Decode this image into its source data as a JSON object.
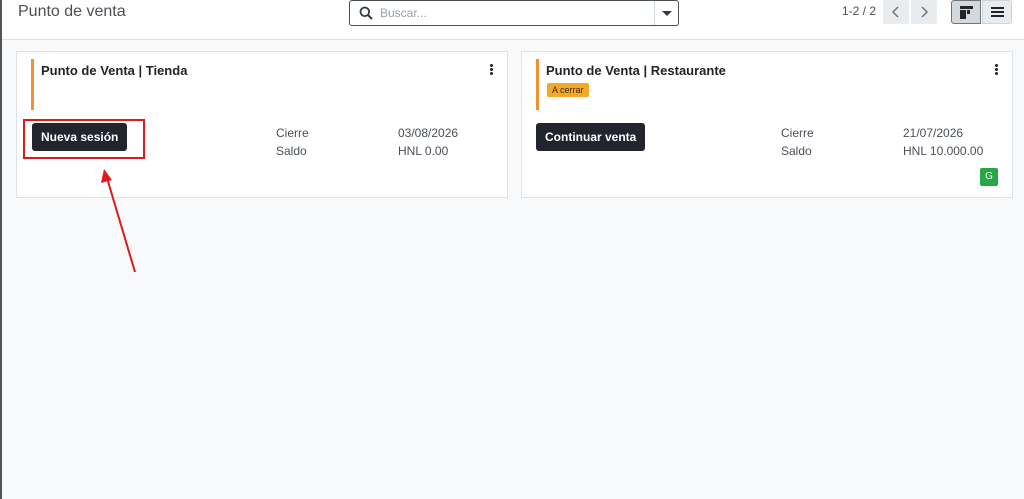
{
  "header": {
    "breadcrumb": "Punto de venta",
    "search": {
      "placeholder": "Buscar...",
      "value": ""
    },
    "pager": {
      "value": "1-2 / 2"
    }
  },
  "cards": [
    {
      "title": "Punto de Venta | Tienda",
      "badge": "",
      "action_label": "Nueva sesión",
      "fields": [
        {
          "label": "Cierre",
          "value": "03/08/2026"
        },
        {
          "label": "Saldo",
          "value": "HNL 0.00"
        }
      ]
    },
    {
      "title": "Punto de Venta | Restaurante",
      "badge": "A cerrar",
      "action_label": "Continuar venta",
      "fields": [
        {
          "label": "Cierre",
          "value": "21/07/2026"
        },
        {
          "label": "Saldo",
          "value": "HNL 10.000.00"
        }
      ],
      "avatar": "G"
    }
  ],
  "colors": {
    "accent": "#f0922f",
    "primary_button": "#22252e",
    "badge": "#f3a927",
    "avatar": "#28a745",
    "annotation": "#e0191d"
  },
  "icons": [
    "search-icon",
    "caret-down-icon",
    "chevron-left-icon",
    "chevron-right-icon",
    "kanban-view-icon",
    "list-view-icon",
    "kebab-menu-icon"
  ]
}
